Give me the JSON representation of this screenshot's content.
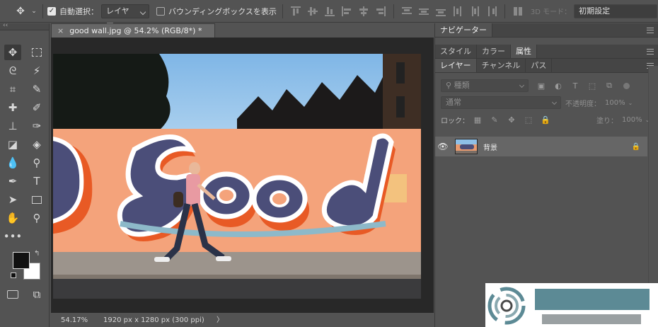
{
  "options_bar": {
    "auto_select_label": "自動選択：",
    "auto_select_value": "レイヤー",
    "bounding_box_label": "バウンディングボックスを表示",
    "mode_3d_label": "3D モード：",
    "workspace_value": "初期設定"
  },
  "document": {
    "tab_title": "good wall.jpg @ 54.2% (RGB/8*) *",
    "close_glyph": "×",
    "image_text": "Good"
  },
  "statusbar": {
    "zoom": "54.17%",
    "dimensions": "1920 px x 1280 px (300 ppi)",
    "arrow": "〉"
  },
  "panels": {
    "navigator_tab": "ナビゲーター",
    "group2_tabs": [
      "スタイル",
      "カラー",
      "属性"
    ],
    "group3_tabs": [
      "レイヤー",
      "チャンネル",
      "パス"
    ],
    "filter_value": "種類",
    "blend_mode": "通常",
    "opacity_label": "不透明度：",
    "opacity_value": "100%",
    "lock_label": "ロック：",
    "fill_label": "塗り：",
    "fill_value": "100%",
    "layer_name": "背景"
  },
  "colors": {
    "ui_bg": "#535353",
    "canvas_bg": "#282828",
    "foreground_swatch": "#111111",
    "background_swatch": "#ffffff",
    "selected_layer_bg": "#666666"
  }
}
